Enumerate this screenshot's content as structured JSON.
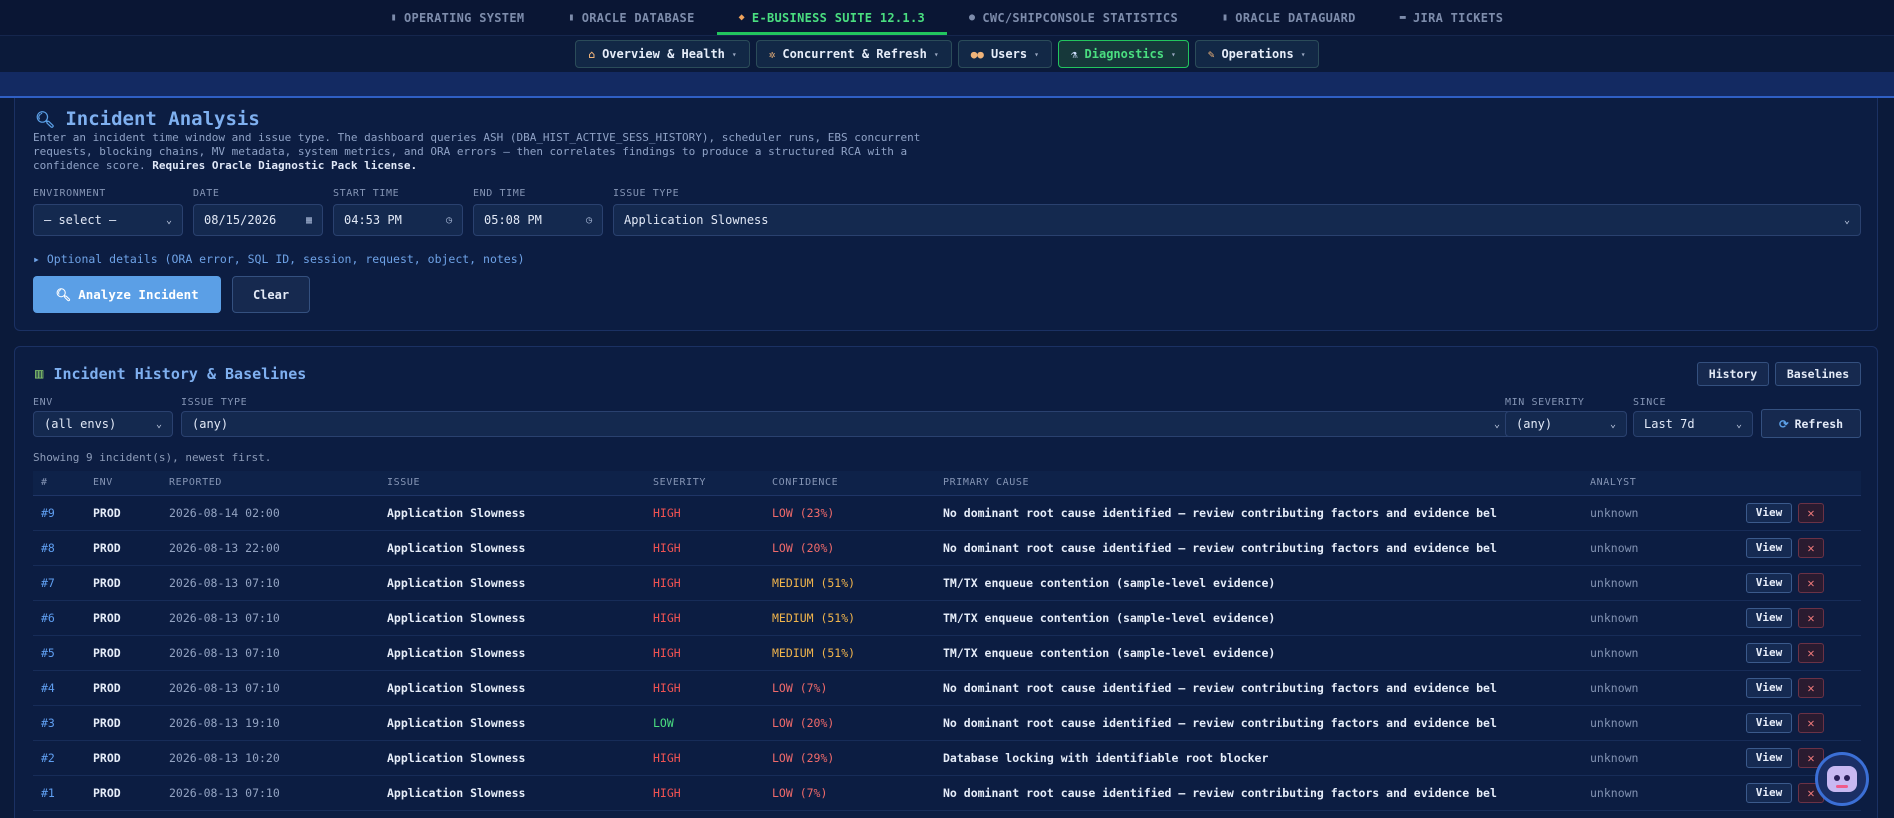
{
  "topnav": [
    {
      "icon": "server-icon",
      "glyph": "▮",
      "label": "OPERATING SYSTEM",
      "active": false
    },
    {
      "icon": "database-icon",
      "glyph": "▮",
      "label": "ORACLE DATABASE",
      "active": false
    },
    {
      "icon": "package-icon",
      "glyph": "◆",
      "label": "E-BUSINESS SUITE 12.1.3",
      "active": true
    },
    {
      "icon": "globe-icon",
      "glyph": "●",
      "label": "CWC/SHIPCONSOLE STATISTICS",
      "active": false
    },
    {
      "icon": "shield-icon",
      "glyph": "▮",
      "label": "ORACLE DATAGUARD",
      "active": false
    },
    {
      "icon": "ticket-icon",
      "glyph": "▬",
      "label": "JIRA TICKETS",
      "active": false
    }
  ],
  "subnav": [
    {
      "icon": "house-icon",
      "glyph": "⌂",
      "label": "Overview & Health",
      "active": false
    },
    {
      "icon": "gear-icon",
      "glyph": "✲",
      "label": "Concurrent & Refresh",
      "active": false
    },
    {
      "icon": "users-icon",
      "glyph": "●●",
      "label": "Users",
      "active": false
    },
    {
      "icon": "microscope-icon",
      "glyph": "⚗",
      "label": "Diagnostics",
      "active": true
    },
    {
      "icon": "wrench-icon",
      "glyph": "✎",
      "label": "Operations",
      "active": false
    }
  ],
  "incident": {
    "title": "Incident Analysis",
    "description": "Enter an incident time window and issue type. The dashboard queries ASH (DBA_HIST_ACTIVE_SESS_HISTORY), scheduler runs, EBS concurrent requests, blocking chains, MV metadata, system metrics, and ORA errors — then correlates findings to produce a structured RCA with a confidence score.",
    "license_note": "Requires Oracle Diagnostic Pack license.",
    "labels": {
      "environment": "ENVIRONMENT",
      "date": "DATE",
      "start": "START TIME",
      "end": "END TIME",
      "issue": "ISSUE TYPE"
    },
    "values": {
      "environment": "— select —",
      "date": "08/15/2026",
      "start": "04:53 PM",
      "end": "05:08 PM",
      "issue": "Application Slowness"
    },
    "optional": "▸ Optional details (ORA error, SQL ID, session, request, object, notes)",
    "analyze_label": "Analyze Incident",
    "clear_label": "Clear"
  },
  "history": {
    "title": "Incident History & Baselines",
    "history_btn": "History",
    "baselines_btn": "Baselines",
    "filters": {
      "env_label": "ENV",
      "env_value": "(all envs)",
      "issue_label": "ISSUE TYPE",
      "issue_value": "(any)",
      "sev_label": "MIN SEVERITY",
      "sev_value": "(any)",
      "since_label": "SINCE",
      "since_value": "Last 7d",
      "refresh": "Refresh"
    },
    "count_text": "Showing 9 incident(s), newest first.",
    "columns": [
      "#",
      "ENV",
      "REPORTED",
      "ISSUE",
      "SEVERITY",
      "CONFIDENCE",
      "PRIMARY CAUSE",
      "ANALYST",
      ""
    ],
    "rows": [
      {
        "id": "#9",
        "env": "PROD",
        "reported": "2026-08-14 02:00",
        "issue": "Application Slowness",
        "severity": "HIGH",
        "confidence": "LOW (23%)",
        "cause": "No dominant root cause identified — review contributing factors and evidence bel",
        "analyst": "unknown"
      },
      {
        "id": "#8",
        "env": "PROD",
        "reported": "2026-08-13 22:00",
        "issue": "Application Slowness",
        "severity": "HIGH",
        "confidence": "LOW (20%)",
        "cause": "No dominant root cause identified — review contributing factors and evidence bel",
        "analyst": "unknown"
      },
      {
        "id": "#7",
        "env": "PROD",
        "reported": "2026-08-13 07:10",
        "issue": "Application Slowness",
        "severity": "HIGH",
        "confidence": "MEDIUM (51%)",
        "cause": "TM/TX enqueue contention (sample-level evidence)",
        "analyst": "unknown"
      },
      {
        "id": "#6",
        "env": "PROD",
        "reported": "2026-08-13 07:10",
        "issue": "Application Slowness",
        "severity": "HIGH",
        "confidence": "MEDIUM (51%)",
        "cause": "TM/TX enqueue contention (sample-level evidence)",
        "analyst": "unknown"
      },
      {
        "id": "#5",
        "env": "PROD",
        "reported": "2026-08-13 07:10",
        "issue": "Application Slowness",
        "severity": "HIGH",
        "confidence": "MEDIUM (51%)",
        "cause": "TM/TX enqueue contention (sample-level evidence)",
        "analyst": "unknown"
      },
      {
        "id": "#4",
        "env": "PROD",
        "reported": "2026-08-13 07:10",
        "issue": "Application Slowness",
        "severity": "HIGH",
        "confidence": "LOW (7%)",
        "cause": "No dominant root cause identified — review contributing factors and evidence bel",
        "analyst": "unknown"
      },
      {
        "id": "#3",
        "env": "PROD",
        "reported": "2026-08-13 19:10",
        "issue": "Application Slowness",
        "severity": "LOW",
        "confidence": "LOW (20%)",
        "cause": "No dominant root cause identified — review contributing factors and evidence bel",
        "analyst": "unknown"
      },
      {
        "id": "#2",
        "env": "PROD",
        "reported": "2026-08-13 10:20",
        "issue": "Application Slowness",
        "severity": "HIGH",
        "confidence": "LOW (29%)",
        "cause": "Database locking with identifiable root blocker",
        "analyst": "unknown"
      },
      {
        "id": "#1",
        "env": "PROD",
        "reported": "2026-08-13 07:10",
        "issue": "Application Slowness",
        "severity": "HIGH",
        "confidence": "LOW (7%)",
        "cause": "No dominant root cause identified — review contributing factors and evidence bel",
        "analyst": "unknown"
      }
    ],
    "view_label": "View",
    "delete_label": "✕"
  },
  "colors": {
    "high": "#f05252",
    "low_sev": "#4ade80",
    "conf_low": "#f06a6a",
    "conf_medium": "#f0b44c",
    "accent": "#22c55e"
  }
}
